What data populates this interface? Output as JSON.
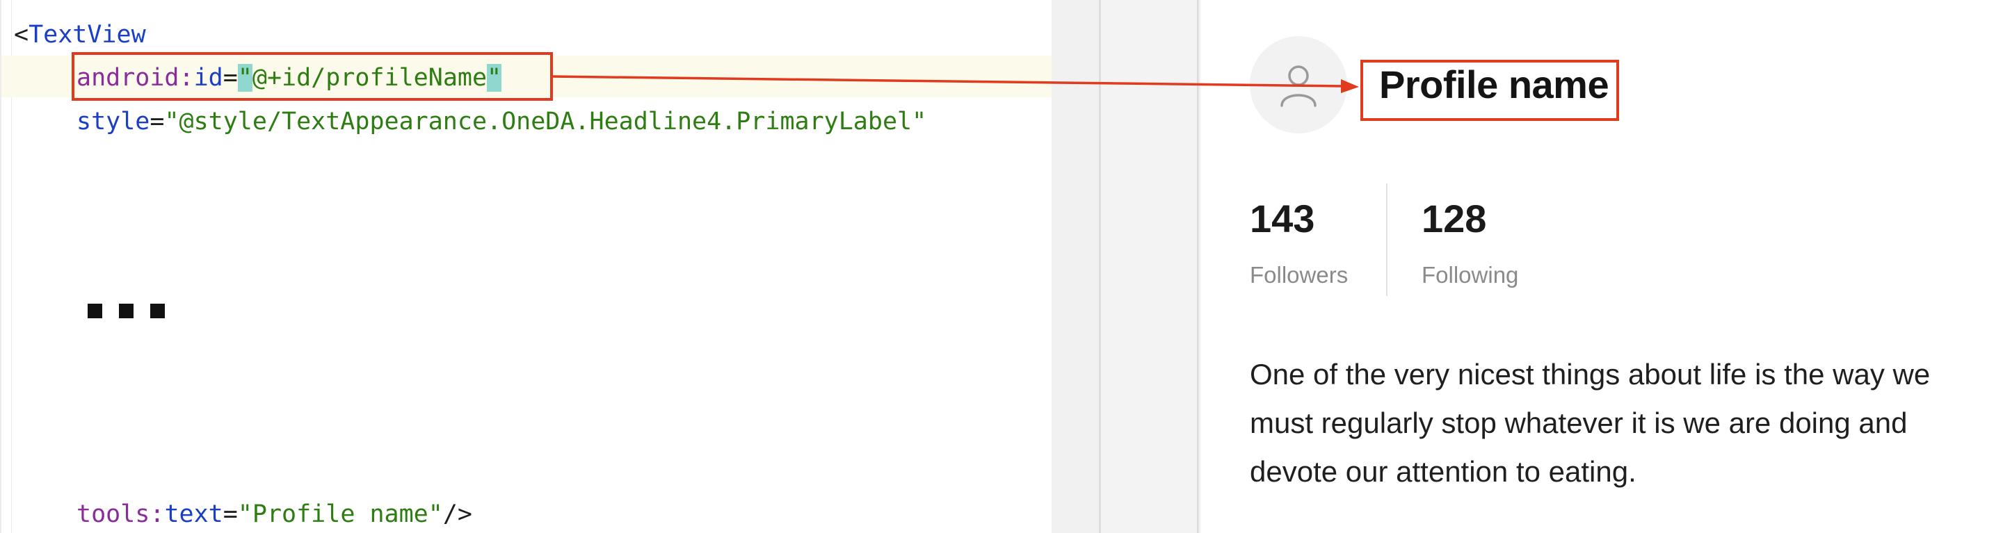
{
  "editor": {
    "line1": {
      "open": "<",
      "tag": "TextView"
    },
    "line2": {
      "ns": "android:",
      "attr": "id",
      "eq": "=",
      "quote_open": "\"",
      "value": "@+id/profileName",
      "quote_close": "\""
    },
    "line3": {
      "attr": "style",
      "eq": "=",
      "value": "\"@style/TextAppearance.OneDA.Headline4.PrimaryLabel\""
    },
    "line4": {
      "ns": "tools:",
      "attr": "text",
      "eq": "=",
      "value": "\"Profile name\"",
      "close": "/>"
    },
    "ellipsis_dots": 3
  },
  "preview": {
    "avatar_icon": "person-icon",
    "profile_name": "Profile name",
    "stats": [
      {
        "value": "143",
        "label": "Followers"
      },
      {
        "value": "128",
        "label": "Following"
      }
    ],
    "bio": "One of the very nicest things about life is the way we must regularly stop whatever it is we are doing and devote our attention to eating."
  },
  "colors": {
    "annotation": "#e03a1f",
    "tag": "#1a3fc4",
    "namespace": "#8a2c9c",
    "string": "#2d7d12",
    "quote_highlight": "#8fd7cf"
  }
}
